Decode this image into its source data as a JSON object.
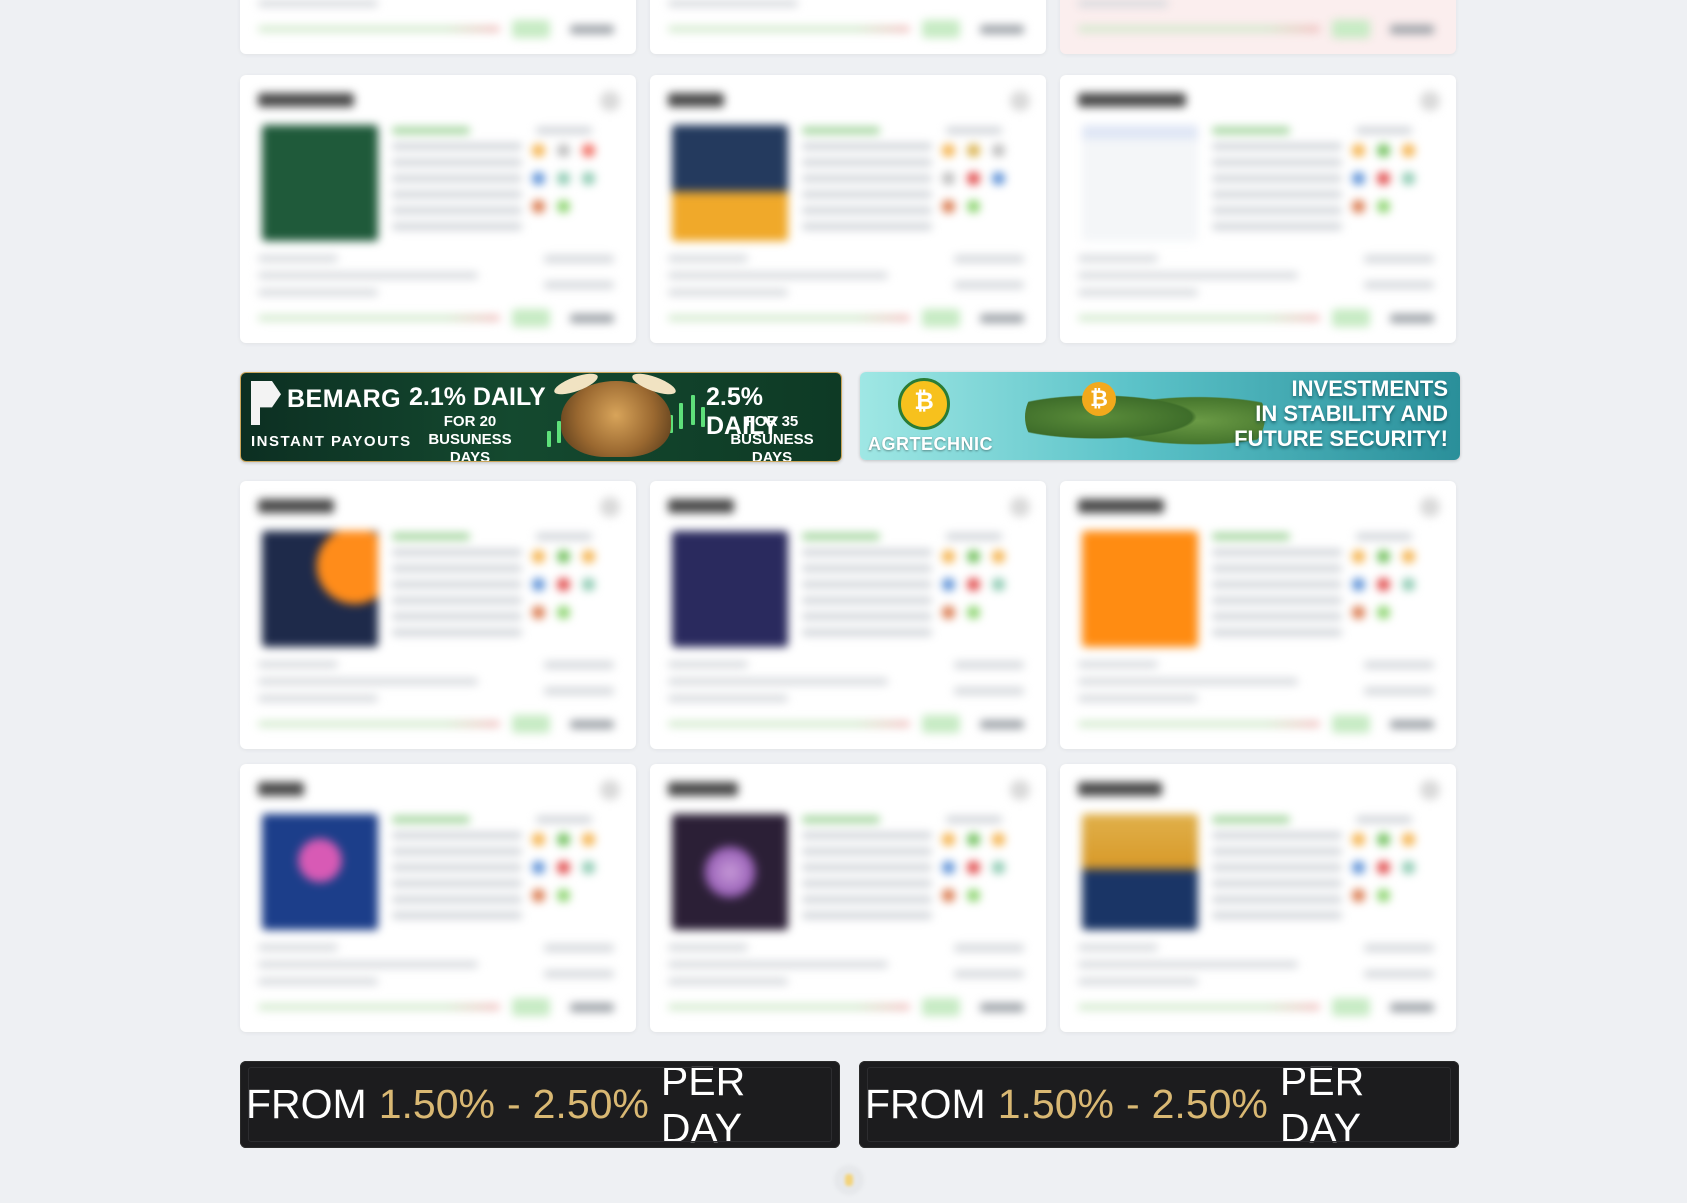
{
  "banners": {
    "bemarg": {
      "brand": "BEMARG",
      "tagline": "INSTANT PAYOUTS",
      "offer1_rate": "2.1% DAILY",
      "offer1_line1": "FOR 20",
      "offer1_line2": "BUSUNESS DAYS",
      "offer2_rate": "2.5% DAILY",
      "offer2_line1": "FOR 35",
      "offer2_line2": "BUSUNESS DAYS"
    },
    "agrtechnic": {
      "brand": "AGRTECHNIC",
      "coin_symbol": "₿",
      "slogan_line1": "INVESTMENTS",
      "slogan_line2": "IN STABILITY AND",
      "slogan_line3": "FUTURE SECURITY!"
    },
    "rate_left": {
      "from": "FROM",
      "low": "1.50%",
      "dash": "-",
      "high": "2.50%",
      "per": "PER DAY"
    },
    "rate_right": {
      "from": "FROM",
      "low": "1.50%",
      "dash": "-",
      "high": "2.50%",
      "per": "PER DAY"
    }
  },
  "cards": {
    "thumb_colors": [
      "#1f5a3a",
      "#f0a92a",
      "#f4f6f8",
      "#ff8c1a",
      "#2a2a5e",
      "#ff8c12",
      "#1c3e8a",
      "#2b1f36",
      "#1a3566"
    ],
    "dot_colors": [
      "#f4b14a",
      "#6fbf5a",
      "#f16a5e",
      "#5a8fd6",
      "#e04848",
      "#8ac9b0",
      "#d9774a",
      "#8bd46e"
    ]
  },
  "colors": {
    "page_bg": "#eef0f3",
    "accent_gold": "#d9b873",
    "banner_dark": "#1c1c1e"
  }
}
